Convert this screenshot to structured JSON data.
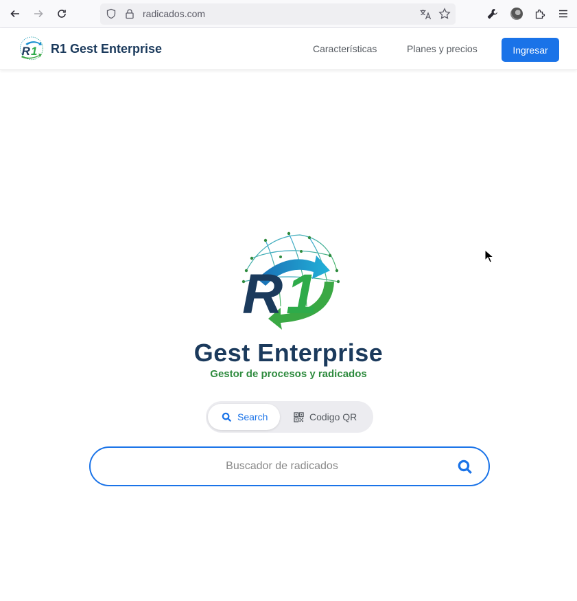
{
  "browser": {
    "url": "radicados.com"
  },
  "header": {
    "brand_name": "R1 Gest Enterprise",
    "nav": [
      {
        "label": "Características"
      },
      {
        "label": "Planes y precios"
      }
    ],
    "login_label": "Ingresar"
  },
  "hero": {
    "title": "Gest Enterprise",
    "subtitle": "Gestor de procesos y radicados"
  },
  "search_modes": [
    {
      "label": "Search",
      "icon": "search-icon",
      "active": true
    },
    {
      "label": "Codigo QR",
      "icon": "qr-code-icon",
      "active": false
    }
  ],
  "search": {
    "placeholder": "Buscador de radicados",
    "value": ""
  },
  "colors": {
    "primary": "#1a73e8",
    "brand_navy": "#1b3a5c",
    "brand_green": "#2e8b3e"
  }
}
